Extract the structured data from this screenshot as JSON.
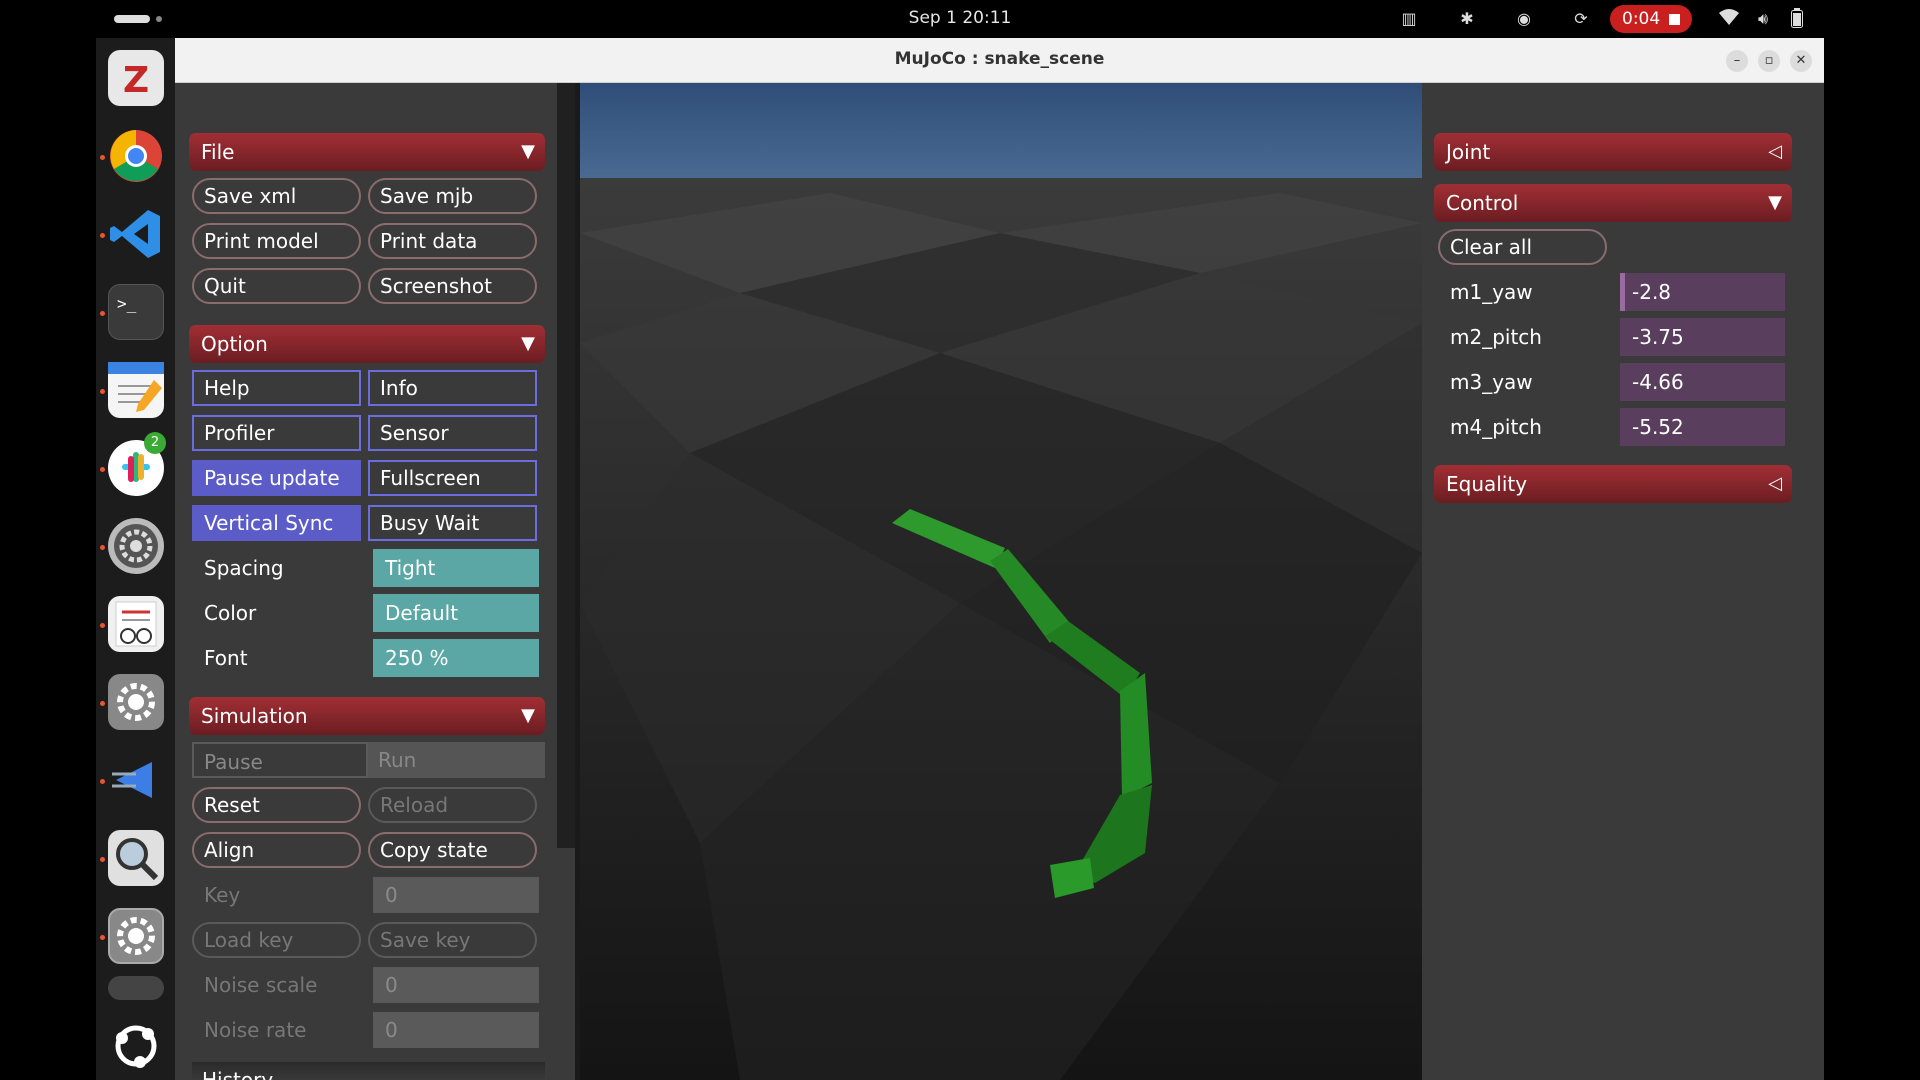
{
  "topbar": {
    "clock": "Sep 1  20:11",
    "recording_time": "0:04"
  },
  "window": {
    "title": "MuJoCo : snake_scene",
    "minimize": "–",
    "maximize": "▫",
    "close": "✕"
  },
  "left_panel": {
    "file": {
      "title": "File",
      "buttons": [
        "Save xml",
        "Save mjb",
        "Print model",
        "Print data",
        "Quit",
        "Screenshot"
      ]
    },
    "option": {
      "title": "Option",
      "toggles": [
        "Help",
        "Info",
        "Profiler",
        "Sensor",
        "Pause update",
        "Fullscreen",
        "Vertical Sync",
        "Busy Wait"
      ],
      "spacing_label": "Spacing",
      "spacing_value": "Tight",
      "color_label": "Color",
      "color_value": "Default",
      "font_label": "Font",
      "font_value": "250 %"
    },
    "simulation": {
      "title": "Simulation",
      "pause": "Pause",
      "run": "Run",
      "reset": "Reset",
      "reload": "Reload",
      "align": "Align",
      "copy_state": "Copy state",
      "key_label": "Key",
      "key_value": "0",
      "load_key": "Load key",
      "save_key": "Save key",
      "noise_scale_label": "Noise scale",
      "noise_scale_value": "0",
      "noise_rate_label": "Noise rate",
      "noise_rate_value": "0",
      "history": "History"
    }
  },
  "right_panel": {
    "joint": "Joint",
    "control": {
      "title": "Control",
      "clear_all": "Clear all",
      "actuators": [
        {
          "name": "m1_yaw",
          "value": "-2.8"
        },
        {
          "name": "m2_pitch",
          "value": "-3.75"
        },
        {
          "name": "m3_yaw",
          "value": "-4.66"
        },
        {
          "name": "m4_pitch",
          "value": "-5.52"
        }
      ]
    },
    "equality": "Equality"
  },
  "colors": {
    "section_header": "#8b2730",
    "toggle_on": "#5b5cc8",
    "select_bg": "#5aa7a6",
    "slider_bg": "#5a3e5e",
    "snake": "#2a8a2a",
    "sky": "#3d5a80",
    "record": "#c9201f"
  }
}
